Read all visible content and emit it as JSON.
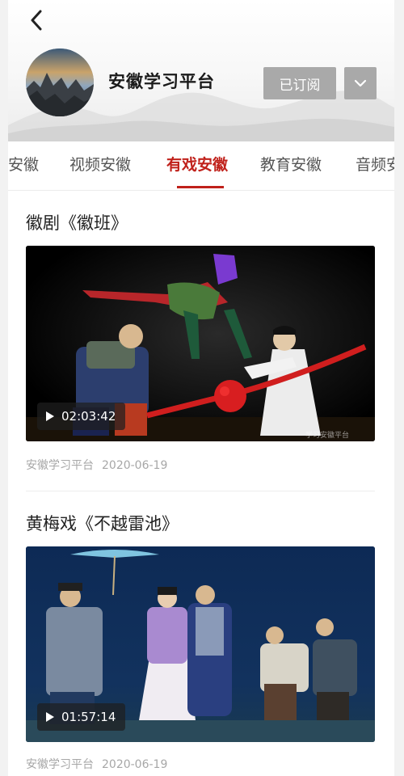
{
  "header": {
    "channel_name": "安徽学习平台",
    "subscribe_label": "已订阅"
  },
  "tabs": [
    {
      "label": "安徽",
      "active": false
    },
    {
      "label": "视频安徽",
      "active": false
    },
    {
      "label": "有戏安徽",
      "active": true
    },
    {
      "label": "教育安徽",
      "active": false
    },
    {
      "label": "音频安徽",
      "active": false
    }
  ],
  "articles": [
    {
      "title": "徽剧《徽班》",
      "duration": "02:03:42",
      "source": "安徽学习平台",
      "date": "2020-06-19",
      "watermark": "学习安徽平台"
    },
    {
      "title": "黄梅戏《不越雷池》",
      "duration": "01:57:14",
      "source": "安徽学习平台",
      "date": "2020-06-19"
    }
  ],
  "colors": {
    "accent": "#c0211b",
    "button_gray": "#a9a9a9"
  }
}
